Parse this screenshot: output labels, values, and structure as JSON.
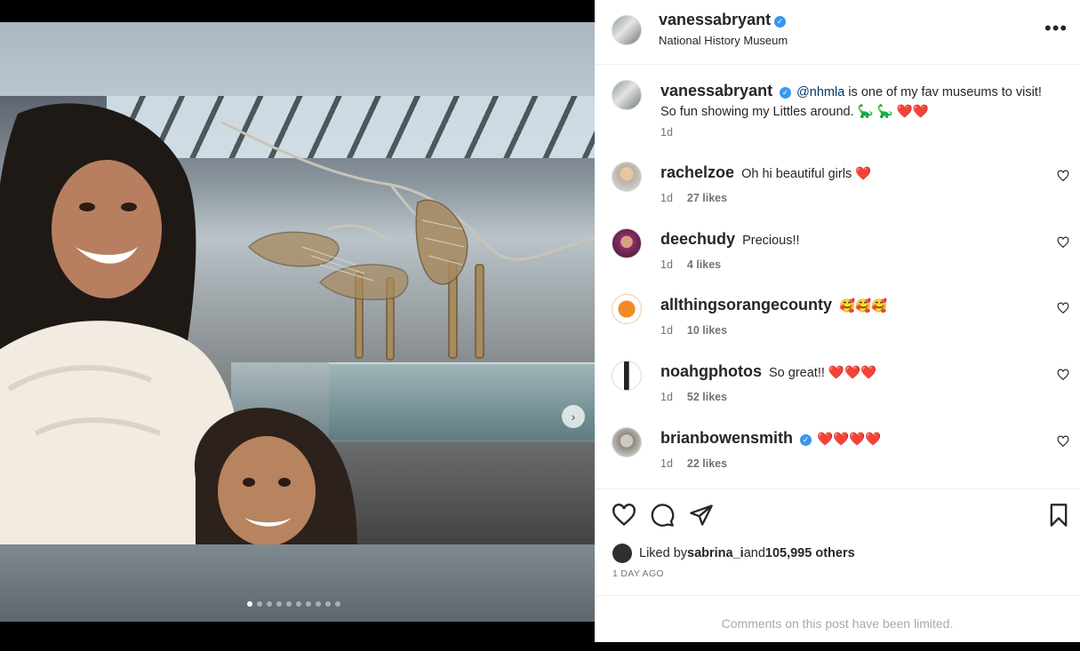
{
  "post": {
    "username": "vanessabryant",
    "location": "National History Museum",
    "carousel": {
      "slide_count": 10,
      "active_index": 0
    }
  },
  "caption": {
    "username": "vanessabryant",
    "mention": "@nhmla",
    "text": " is one of my fav museums to visit! So fun showing my Littles around. 🦕 🦕 ❤️❤️",
    "time": "1d"
  },
  "comments": [
    {
      "username": "rachelzoe",
      "text": "Oh hi beautiful girls ❤️",
      "time": "1d",
      "likes": "27 likes",
      "verified": false
    },
    {
      "username": "deechudy",
      "text": "Precious!!",
      "time": "1d",
      "likes": "4 likes",
      "verified": false
    },
    {
      "username": "allthingsorangecounty",
      "text": "🥰🥰🥰",
      "time": "1d",
      "likes": "10 likes",
      "verified": false
    },
    {
      "username": "noahgphotos",
      "text": "So great!! ❤️❤️❤️",
      "time": "1d",
      "likes": "52 likes",
      "verified": false
    },
    {
      "username": "brianbowensmith",
      "text": "❤️❤️❤️❤️",
      "time": "1d",
      "likes": "22 likes",
      "verified": true
    }
  ],
  "likes": {
    "prefix": "Liked by ",
    "user": "sabrina_i",
    "middle": " and ",
    "count": "105,995 others"
  },
  "timeago": "1 DAY AGO",
  "comments_limited": "Comments on this post have been limited.",
  "icons": {
    "like": "heart-icon",
    "comment": "comment-icon",
    "share": "share-icon",
    "save": "bookmark-icon",
    "more": "more-horizontal-icon",
    "next": "chevron-right-icon"
  },
  "colors": {
    "verified": "#3897f0",
    "mention": "#00376b",
    "muted": "#737373"
  }
}
